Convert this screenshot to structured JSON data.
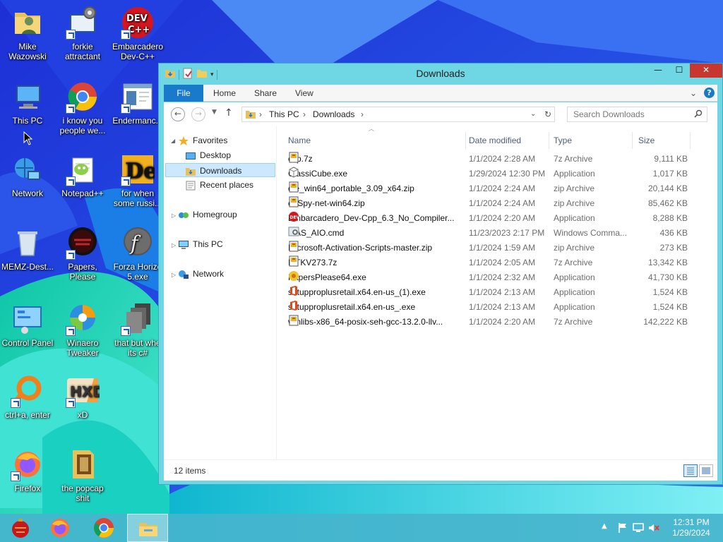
{
  "desktop": {
    "icons": [
      {
        "label": "Mike Wazowski",
        "icon": "user-folder-icon"
      },
      {
        "label": "forkie attractant",
        "icon": "control-panel-gears-icon"
      },
      {
        "label": "Embarcadero Dev-C++",
        "icon": "devcpp-icon"
      },
      {
        "label": "This PC",
        "icon": "computer-icon"
      },
      {
        "label": "i know you people we...",
        "icon": "chrome-icon"
      },
      {
        "label": "Endermanc...",
        "icon": "window-app-icon"
      },
      {
        "label": "Network",
        "icon": "network-globe-icon"
      },
      {
        "label": "Notepad++",
        "icon": "notepadpp-icon"
      },
      {
        "label": "for when some russi...",
        "icon": "detect-it-easy-icon"
      },
      {
        "label": "MEMZ-Dest...",
        "icon": "recycle-bin-icon"
      },
      {
        "label": "Papers, Please",
        "icon": "papers-please-icon"
      },
      {
        "label": "Forza Horizo 5.exe",
        "icon": "flash-icon"
      },
      {
        "label": "Control Panel",
        "icon": "control-panel-icon"
      },
      {
        "label": "Winaero Tweaker",
        "icon": "winaero-icon"
      },
      {
        "label": "that but whe its c#",
        "icon": "stacked-windows-icon"
      },
      {
        "label": "ctrl+a, enter",
        "icon": "orange-ring-icon"
      },
      {
        "label": "xD",
        "icon": "hxd-icon"
      },
      {
        "label": "Firefox",
        "icon": "firefox-icon"
      },
      {
        "label": "the popcap shit",
        "icon": "popcap-folder-icon"
      }
    ]
  },
  "window": {
    "title": "Downloads",
    "controls": {
      "minimize": "—",
      "maximize": "☐",
      "close": "✕"
    },
    "ribbon": {
      "tabs": [
        "File",
        "Home",
        "Share",
        "View"
      ],
      "expand_icon": "⌄",
      "help_icon": "?"
    },
    "address": {
      "crumbs": [
        "This PC",
        "Downloads"
      ],
      "separator": "›"
    },
    "search": {
      "placeholder": "Search Downloads"
    },
    "nav_pane": {
      "favorites_label": "Favorites",
      "favorites": [
        "Desktop",
        "Downloads",
        "Recent places"
      ],
      "selected": "Downloads",
      "groups": [
        "Homegroup",
        "This PC",
        "Network"
      ]
    },
    "columns": {
      "name": "Name",
      "date": "Date modified",
      "type": "Type",
      "size": "Size"
    },
    "files": [
      {
        "name": "ccp.7z",
        "date": "1/1/2024 2:28 AM",
        "type": "7z Archive",
        "size": "9,111 KB",
        "icon": "archive-icon"
      },
      {
        "name": "ClassiCube.exe",
        "date": "1/29/2024 12:30 PM",
        "type": "Application",
        "size": "1,017 KB",
        "icon": "cube-icon"
      },
      {
        "name": "die_win64_portable_3.09_x64.zip",
        "date": "1/1/2024 2:24 AM",
        "type": "zip Archive",
        "size": "20,144 KB",
        "icon": "archive-icon"
      },
      {
        "name": "dnSpy-net-win64.zip",
        "date": "1/1/2024 2:24 AM",
        "type": "zip Archive",
        "size": "85,462 KB",
        "icon": "archive-icon"
      },
      {
        "name": "Embarcadero_Dev-Cpp_6.3_No_Compiler...",
        "date": "1/1/2024 2:20 AM",
        "type": "Application",
        "size": "8,288 KB",
        "icon": "devcpp-small-icon"
      },
      {
        "name": "MAS_AIO.cmd",
        "date": "11/23/2023 2:17 PM",
        "type": "Windows Comma...",
        "size": "436 KB",
        "icon": "cmd-gear-icon"
      },
      {
        "name": "Microsoft-Activation-Scripts-master.zip",
        "date": "1/1/2024 1:59 AM",
        "type": "zip Archive",
        "size": "273 KB",
        "icon": "archive-icon"
      },
      {
        "name": "MTKV273.7z",
        "date": "1/1/2024 2:05 AM",
        "type": "7z Archive",
        "size": "13,342 KB",
        "icon": "archive-icon"
      },
      {
        "name": "PapersPlease64.exe",
        "date": "1/1/2024 2:32 AM",
        "type": "Application",
        "size": "41,730 KB",
        "icon": "papers-small-icon"
      },
      {
        "name": "setupproplusretail.x64.en-us_(1).exe",
        "date": "1/1/2024 2:13 AM",
        "type": "Application",
        "size": "1,524 KB",
        "icon": "office-icon"
      },
      {
        "name": "setupproplusretail.x64.en-us_.exe",
        "date": "1/1/2024 2:13 AM",
        "type": "Application",
        "size": "1,524 KB",
        "icon": "office-icon"
      },
      {
        "name": "winlibs-x86_64-posix-seh-gcc-13.2.0-llv...",
        "date": "1/1/2024 2:20 AM",
        "type": "7z Archive",
        "size": "142,222 KB",
        "icon": "archive-icon"
      }
    ],
    "status": {
      "item_count": "12 items"
    }
  },
  "taskbar": {
    "pinned": [
      "ornament-start-icon",
      "firefox-icon",
      "chrome-icon",
      "file-explorer-icon"
    ],
    "active": "file-explorer-icon",
    "clock": {
      "time": "12:31 PM",
      "date": "1/29/2024"
    }
  },
  "colors": {
    "window_frame": "#6fd6e3",
    "file_tab": "#1979ca",
    "close_button": "#c7372f",
    "selection": "#cce8ff",
    "taskbar": "#46b4cd"
  }
}
